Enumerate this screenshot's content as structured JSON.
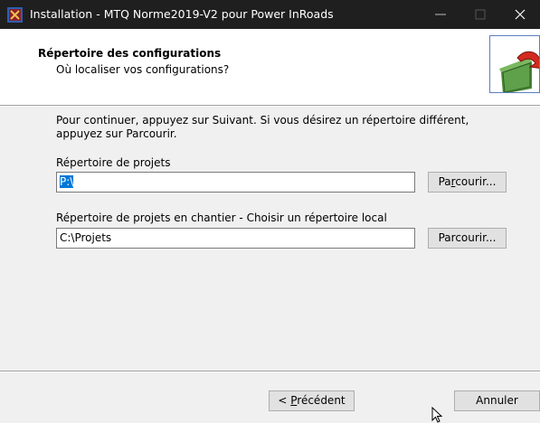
{
  "window": {
    "title": "Installation - MTQ Norme2019-V2 pour Power InRoads",
    "app_icon": "installer-icon",
    "controls": [
      "minimize-icon",
      "maximize-icon",
      "close-icon"
    ]
  },
  "header": {
    "title": "Répertoire des configurations",
    "subtitle": "Où localiser vos configurations?",
    "graphic": "folder-arrow-icon"
  },
  "content": {
    "intro": "Pour continuer, appuyez sur Suivant. Si vous désirez un répertoire différent, appuyez sur Parcourir.",
    "projects_label": "Répertoire de projets",
    "projects_value": "P:\\",
    "projects_browse": {
      "pre": "Pa",
      "accel": "r",
      "post": "courir..."
    },
    "site_label": "Répertoire de projets en chantier - Choisir un répertoire local",
    "site_value": "C:\\Projets",
    "site_browse": "Parcourir..."
  },
  "footer": {
    "prev": {
      "pre": "< ",
      "accel": "P",
      "post": "récédent"
    },
    "cancel": "Annuler"
  },
  "colors": {
    "titlebar": "#1f1f1f",
    "selection": "#0078d7",
    "panel": "#f0f0f0"
  }
}
